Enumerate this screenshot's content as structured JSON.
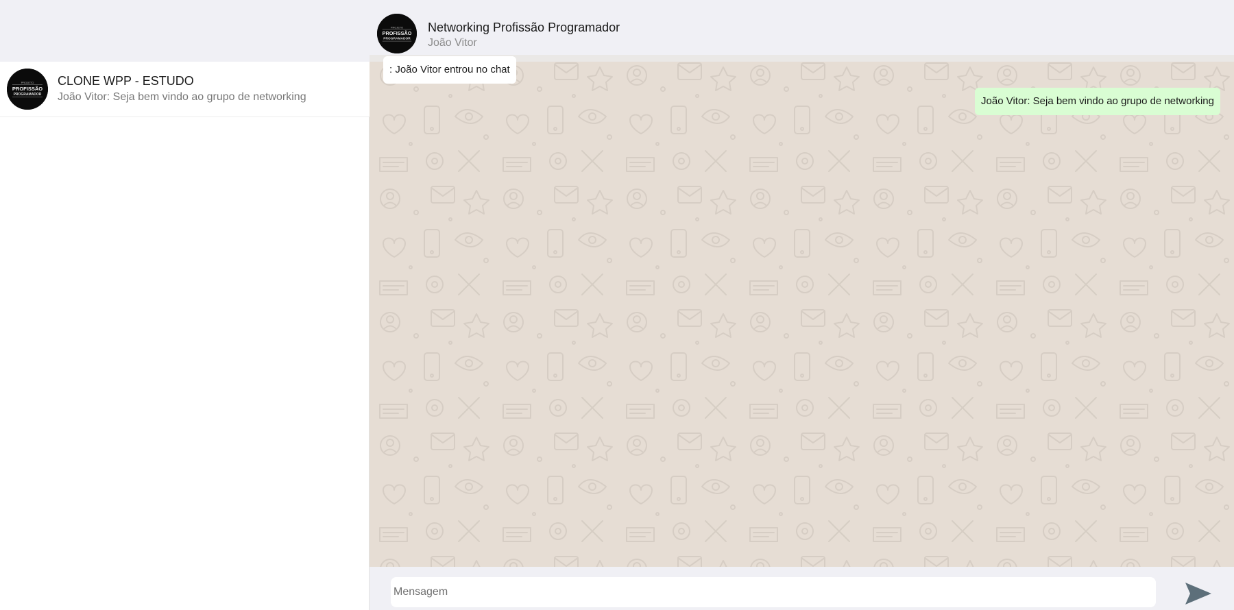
{
  "sidebar": {
    "chats": [
      {
        "title": "CLONE WPP - ESTUDO",
        "preview": "João Vitor: Seja bem vindo ao grupo de networking",
        "avatar_icon": "projeto-profissao-programador-logo"
      }
    ]
  },
  "chat": {
    "title": "Networking Profissão Programador",
    "subtitle": "João Vitor",
    "avatar_icon": "projeto-profissao-programador-logo",
    "messages": [
      {
        "type": "system",
        "text": ": João Vitor entrou no chat"
      },
      {
        "type": "outgoing",
        "text": "João Vitor: Seja bem vindo ao grupo de networking"
      }
    ]
  },
  "logo": {
    "line1": "PROJETO",
    "line2": "PROFISSÃO",
    "line3": "PROGRAMADOR"
  },
  "composer": {
    "placeholder": "Mensagem",
    "send_icon": "send-icon"
  },
  "colors": {
    "header_bg": "#f0f0f5",
    "chat_bg": "#e6ddd4",
    "outgoing_bubble": "#d9fdd3",
    "system_bubble": "#ffffff",
    "send_icon": "#5d6f7a"
  }
}
